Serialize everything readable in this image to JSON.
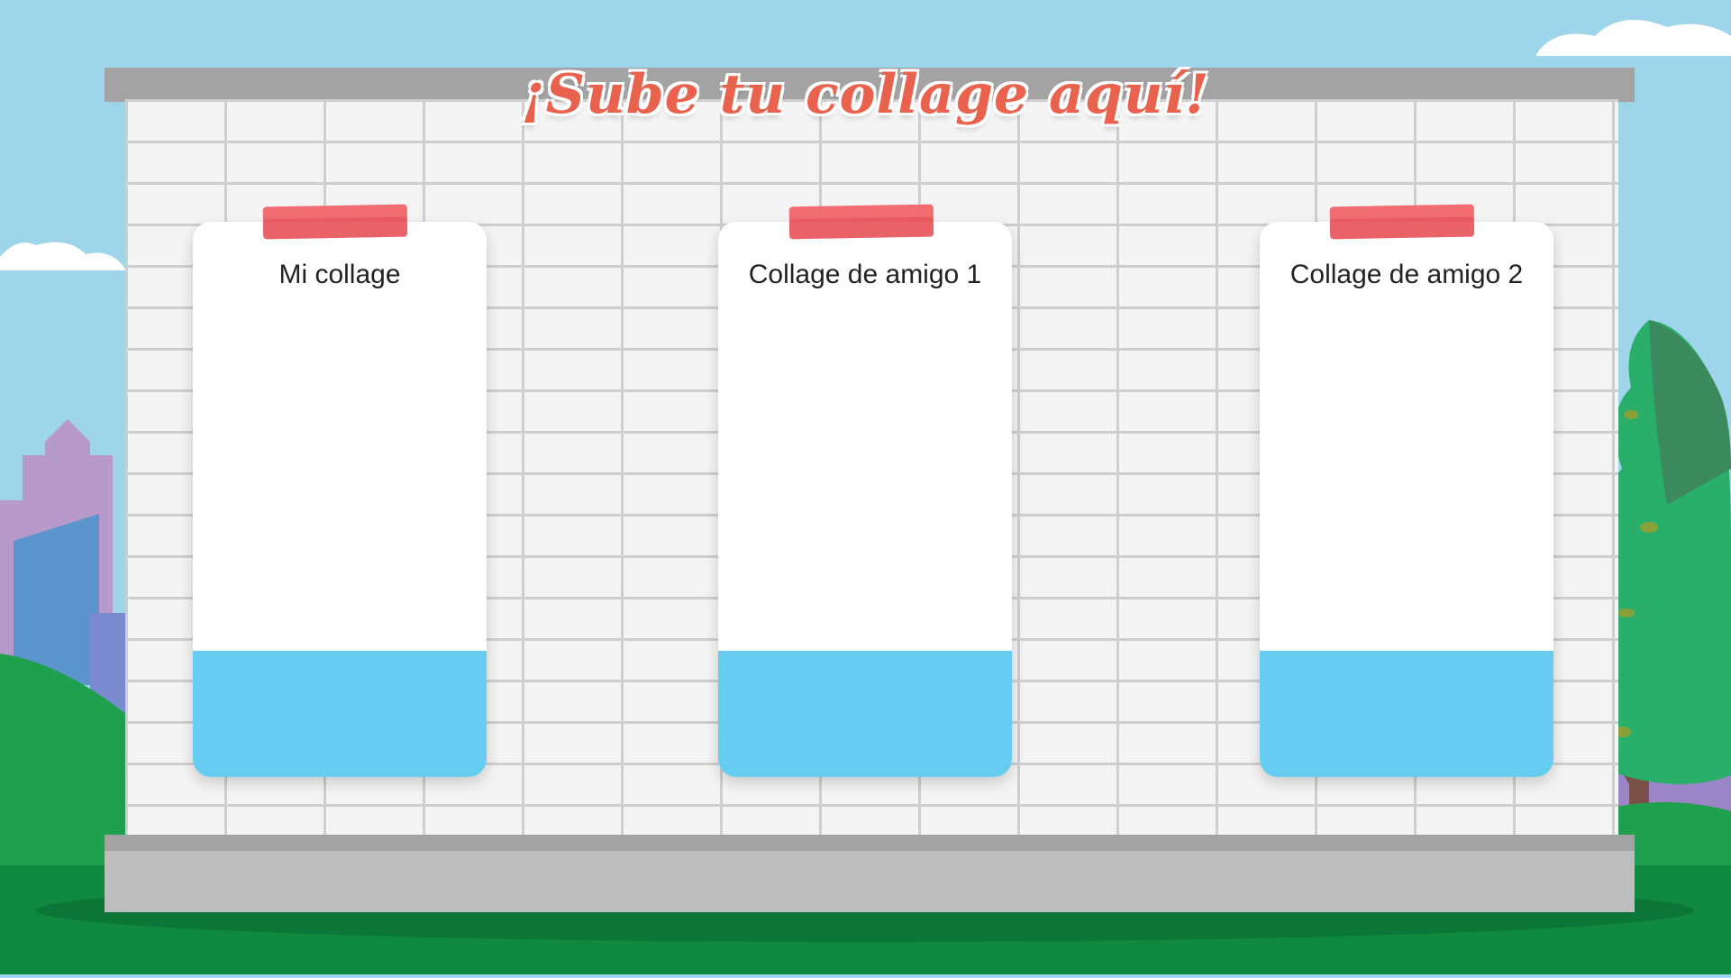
{
  "title": "¡Sube tu collage aquí!",
  "cards": [
    {
      "label": "Mi collage"
    },
    {
      "label": "Collage de amigo 1"
    },
    {
      "label": "Collage de amigo 2"
    }
  ],
  "colors": {
    "title": "#e8624e",
    "tape": "#f0656a",
    "card_footer": "#67cdf0",
    "sky": "#9fd5ea",
    "wall": "#f4f4f4",
    "grass": "#0f8840",
    "tree": "#2aaf6b"
  }
}
